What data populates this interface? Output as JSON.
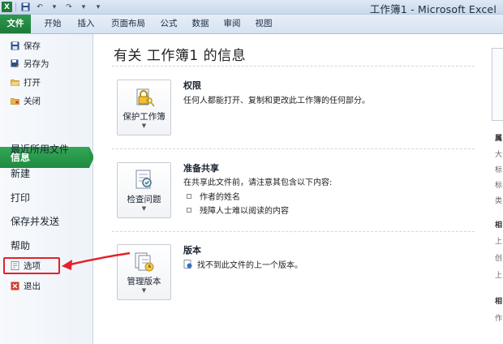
{
  "title_bar": {
    "window_title": "工作簿1 - Microsoft Excel"
  },
  "ribbon_tabs": [
    "文件",
    "开始",
    "插入",
    "页面布局",
    "公式",
    "数据",
    "审阅",
    "视图"
  ],
  "left_nav": {
    "commands": [
      {
        "label": "保存",
        "icon": "save-icon"
      },
      {
        "label": "另存为",
        "icon": "save-as-icon"
      },
      {
        "label": "打开",
        "icon": "open-folder-icon"
      },
      {
        "label": "关闭",
        "icon": "close-folder-icon"
      }
    ],
    "items": [
      "信息",
      "最近所用文件",
      "新建",
      "打印",
      "保存并发送",
      "帮助"
    ],
    "active_item": "信息",
    "footer": [
      {
        "label": "选项",
        "icon": "options-icon"
      },
      {
        "label": "退出",
        "icon": "exit-icon"
      }
    ]
  },
  "main": {
    "title": "有关 工作簿1 的信息",
    "sections": [
      {
        "button_label": "保护工作簿",
        "button_icon": "lock-key-icon",
        "title": "权限",
        "description": "任何人都能打开、复制和更改此工作簿的任何部分。"
      },
      {
        "button_label": "检查问题",
        "button_icon": "inspect-document-icon",
        "title": "准备共享",
        "description": "在共享此文件前，请注意其包含以下内容:",
        "bullets": [
          "作者的姓名",
          "残障人士难以阅读的内容"
        ]
      },
      {
        "button_label": "管理版本",
        "button_icon": "manage-versions-icon",
        "title": "版本",
        "description": "找不到此文件的上一个版本。"
      }
    ]
  },
  "right_panel": {
    "fragments": [
      "属",
      "大",
      "标",
      "标",
      "类",
      "相",
      "上",
      "创",
      "上",
      "相",
      "作"
    ]
  },
  "colors": {
    "file_tab": "#1f7a3a",
    "active_nav": "#2a9a48",
    "highlight": "#e6202a"
  }
}
